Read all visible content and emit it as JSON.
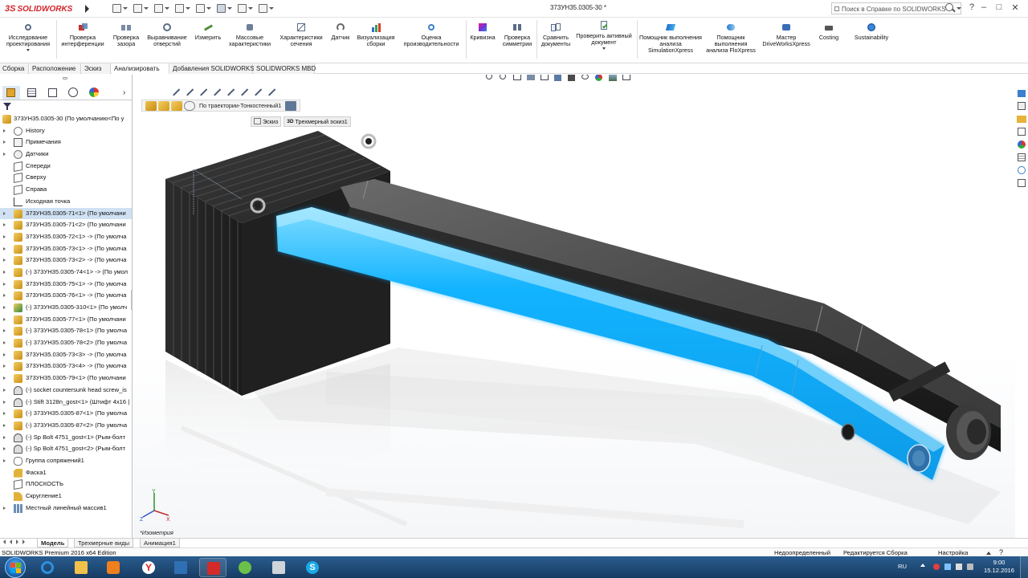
{
  "app": {
    "logo_text": "SOLIDWORKS",
    "logo_prefix": "3S",
    "document_title": "373УН35.0305-30 *",
    "help_search_placeholder": "Поиск в Справке по SOLIDWORKS"
  },
  "ribbon": {
    "buttons": [
      {
        "id": "design-study",
        "label": "Исследование проектирования"
      },
      {
        "id": "interference",
        "label": "Проверка интерференции"
      },
      {
        "id": "clearance",
        "label": "Проверка зазора"
      },
      {
        "id": "hole-alignment",
        "label": "Выравнивание отверстий"
      },
      {
        "id": "measure",
        "label": "Измерить"
      },
      {
        "id": "mass-props",
        "label": "Массовые характеристики"
      },
      {
        "id": "section-props",
        "label": "Характеристики сечения"
      },
      {
        "id": "sensor",
        "label": "Датчик"
      },
      {
        "id": "assembly-vis",
        "label": "Визуализация сборки"
      },
      {
        "id": "performance",
        "label": "Оценка производительности"
      },
      {
        "id": "curvature",
        "label": "Кривизна"
      },
      {
        "id": "symmetry",
        "label": "Проверка симметрии"
      },
      {
        "id": "compare",
        "label": "Сравнить документы"
      },
      {
        "id": "check-active",
        "label": "Проверить активный документ"
      },
      {
        "id": "simxpress",
        "label": "Помощник выполнения анализа SimulationXpress"
      },
      {
        "id": "floxpress",
        "label": "Помощник выполнения анализа FloXpress"
      },
      {
        "id": "driveworks",
        "label": "Мастер DriveWorksXpress"
      },
      {
        "id": "costing",
        "label": "Costing"
      },
      {
        "id": "sustainability",
        "label": "Sustainability"
      }
    ]
  },
  "tabs": [
    {
      "label": "Сборка",
      "active": false
    },
    {
      "label": "Расположение",
      "active": false
    },
    {
      "label": "Эскиз",
      "active": false
    },
    {
      "label": "Анализировать",
      "active": true
    },
    {
      "label": "Добавления SOLIDWORKS",
      "active": false
    },
    {
      "label": "SOLIDWORKS MBD",
      "active": false
    }
  ],
  "tree": {
    "root": "373УН35.0305-30  (По умолчанию<По у",
    "items": [
      {
        "label": "History",
        "icon": "history-icon",
        "sel": false
      },
      {
        "label": "Примечания",
        "icon": "annotations-icon",
        "sel": false
      },
      {
        "label": "Датчики",
        "icon": "sensor-icon",
        "sel": false
      },
      {
        "label": "Спереди",
        "icon": "plane-icon",
        "sel": false
      },
      {
        "label": "Сверху",
        "icon": "plane-icon",
        "sel": false
      },
      {
        "label": "Справа",
        "icon": "plane-icon",
        "sel": false
      },
      {
        "label": "Исходная точка",
        "icon": "origin-icon",
        "sel": false
      },
      {
        "label": "373УН35.0305-71<1> (По умолчани",
        "icon": "part-icon",
        "sel": true
      },
      {
        "label": "373УН35.0305-71<2> (По умолчани",
        "icon": "part-icon",
        "sel": false
      },
      {
        "label": "373УН35.0305-72<1> -> (По умолча",
        "icon": "part-icon",
        "sel": false
      },
      {
        "label": "373УН35.0305-73<1> -> (По умолча",
        "icon": "part-icon",
        "sel": false
      },
      {
        "label": "373УН35.0305-73<2> -> (По умолча",
        "icon": "part-icon",
        "sel": false
      },
      {
        "label": "(-) 373УН35.0305-74<1> -> (По умол",
        "icon": "part-icon",
        "sel": false
      },
      {
        "label": "373УН35.0305-75<1> -> (По умолча",
        "icon": "part-icon",
        "sel": false
      },
      {
        "label": "373УН35.0305-76<1> -> (По умолча",
        "icon": "part-icon",
        "sel": false
      },
      {
        "label": "(-) 373УН35.0305-310<1> (По умолч",
        "icon": "subassembly-icon",
        "sel": false
      },
      {
        "label": "373УН35.0305-77<1> (По умолчани",
        "icon": "part-icon",
        "sel": false
      },
      {
        "label": "(-) 373УН35.0305-78<1> (По умолча",
        "icon": "part-icon",
        "sel": false
      },
      {
        "label": "(-) 373УН35.0305-78<2> (По умолча",
        "icon": "part-icon",
        "sel": false
      },
      {
        "label": "373УН35.0305-73<3> -> (По умолча",
        "icon": "part-icon",
        "sel": false
      },
      {
        "label": "373УН35.0305-73<4> -> (По умолча",
        "icon": "part-icon",
        "sel": false
      },
      {
        "label": "373УН35.0305-79<1> (По умолчани",
        "icon": "part-icon",
        "sel": false
      },
      {
        "label": "(-) socket countersunk head screw_is",
        "icon": "screw-icon",
        "sel": false
      },
      {
        "label": "(-) Stift 3128n_gost<1> (Штифт 4х16 |",
        "icon": "screw-icon",
        "sel": false
      },
      {
        "label": "(-) 373УН35.0305-87<1> (По умолча",
        "icon": "part-icon",
        "sel": false
      },
      {
        "label": "(-) 373УН35.0305-87<2> (По умолча",
        "icon": "part-icon",
        "sel": false
      },
      {
        "label": "(-) Sp Bolt 4751_gost<1> (Рым-болт",
        "icon": "screw-icon",
        "sel": false
      },
      {
        "label": "(-) Sp Bolt 4751_gost<2> (Рым-болт",
        "icon": "screw-icon",
        "sel": false
      },
      {
        "label": "Группа сопряжений1",
        "icon": "mates-icon",
        "sel": false
      },
      {
        "label": "Фаска1",
        "icon": "chamfer-icon",
        "sel": false
      },
      {
        "label": "ПЛОСКОСТЬ",
        "icon": "plane-icon",
        "sel": false
      },
      {
        "label": "Скругление1",
        "icon": "fillet-icon",
        "sel": false
      },
      {
        "label": "Местный линейный массив1",
        "icon": "pattern-icon",
        "sel": false
      }
    ]
  },
  "breadcrumb": {
    "feature": "По траектории-Тонкостенный1",
    "sketch": "Эскиз",
    "sketch3d_tag": "3D",
    "sketch3d": "Трехмерный эскиз1"
  },
  "viewport": {
    "view_name": "*Изометрия",
    "triad_x": "X",
    "triad_y": "Y",
    "triad_z": "Z"
  },
  "bottom_tabs": [
    {
      "label": "Модель",
      "active": true
    },
    {
      "label": "Трехмерные виды",
      "active": false
    },
    {
      "label": "Анимация1",
      "active": false
    }
  ],
  "status": {
    "edition": "SOLIDWORKS Premium 2016 x64 Edition",
    "definition": "Недоопределенный",
    "editing": "Редактируется Сборка",
    "custom": "Настройка"
  },
  "taskbar": {
    "language": "RU",
    "time": "9:00",
    "date": "15.12.2016"
  },
  "colors": {
    "selection_blue": "#00a8ff",
    "part_dark": "#2a2a2a",
    "logo_red": "#d2232a",
    "taskbar": "#1b4a7a"
  }
}
